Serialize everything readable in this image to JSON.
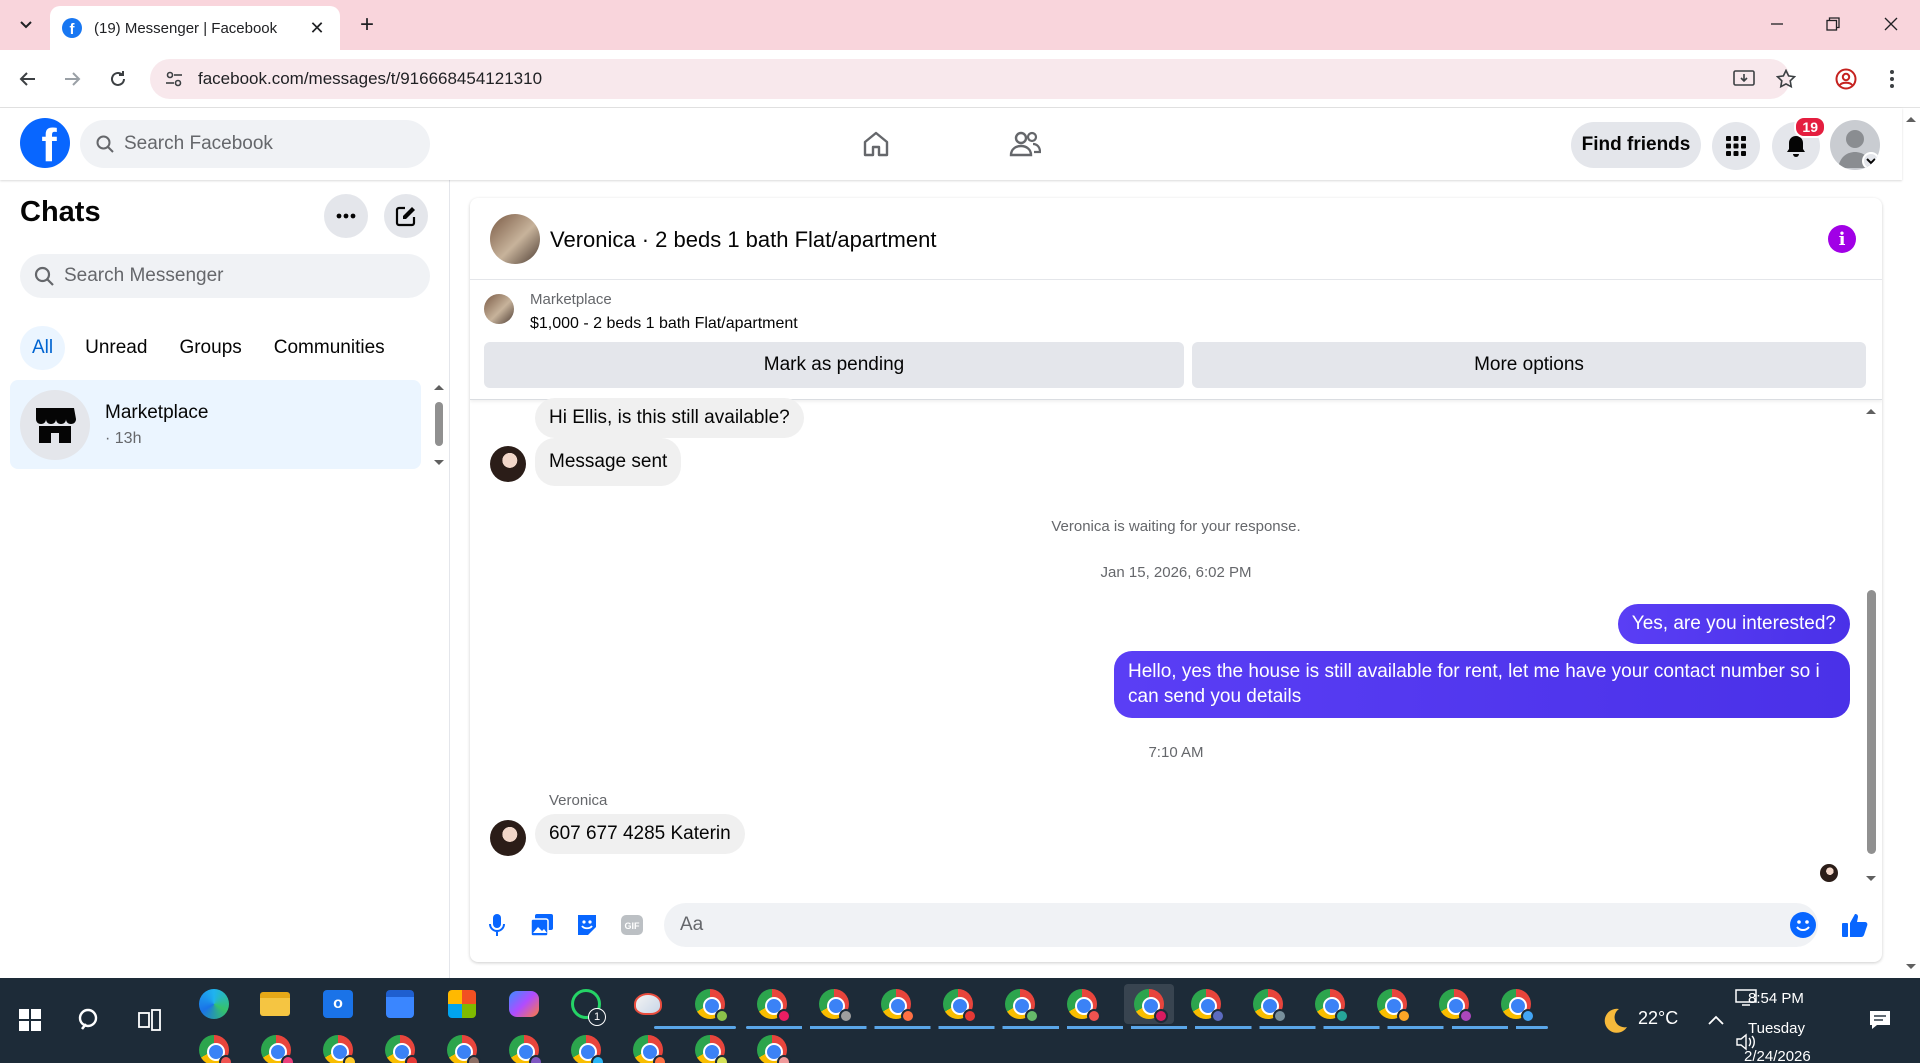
{
  "browser": {
    "tab_title": "(19) Messenger | Facebook",
    "url": "facebook.com/messages/t/916668454121310"
  },
  "facebook": {
    "search_placeholder": "Search Facebook",
    "find_friends_label": "Find friends",
    "notification_count": "19"
  },
  "chats": {
    "title": "Chats",
    "search_placeholder": "Search Messenger",
    "filters": [
      "All",
      "Unread",
      "Groups",
      "Communities"
    ],
    "active_filter": "All",
    "items": [
      {
        "name": "Marketplace",
        "time": "· 13h"
      }
    ]
  },
  "conversation": {
    "title": "Veronica · 2 beds 1 bath Flat/apartment",
    "marketplace_label": "Marketplace",
    "listing": "$1,000 - 2 beds 1 bath Flat/apartment",
    "mark_pending_label": "Mark as pending",
    "more_options_label": "More options",
    "messages": [
      {
        "from": "them",
        "text": "Hi Ellis, is this still available?"
      },
      {
        "from": "them",
        "text": "Message sent"
      },
      {
        "type": "system",
        "text": "Veronica is waiting for your response."
      },
      {
        "type": "timestamp",
        "text": "Jan 15, 2026, 6:02 PM"
      },
      {
        "from": "me",
        "text": "Yes, are you interested?"
      },
      {
        "from": "me",
        "text": "Hello, yes the house is still available for rent, let me have your contact number so i can send you details"
      },
      {
        "type": "timestamp",
        "text": "7:10 AM"
      },
      {
        "type": "sender",
        "text": "Veronica"
      },
      {
        "from": "them",
        "text": "607 677 4285 Katerin"
      }
    ],
    "composer_placeholder": "Aa"
  },
  "taskbar": {
    "whatsapp_badge": "1",
    "weather_temp": "22°C",
    "time": "8:54 PM",
    "day": "Tuesday",
    "date": "2/24/2026"
  },
  "colors": {
    "fb_blue": "#0866ff",
    "outgoing_bubble": "#5a3ef5",
    "incoming_bubble": "#f0f0f0",
    "tab_strip": "#f9d5dc",
    "taskbar": "#1d2b38"
  }
}
